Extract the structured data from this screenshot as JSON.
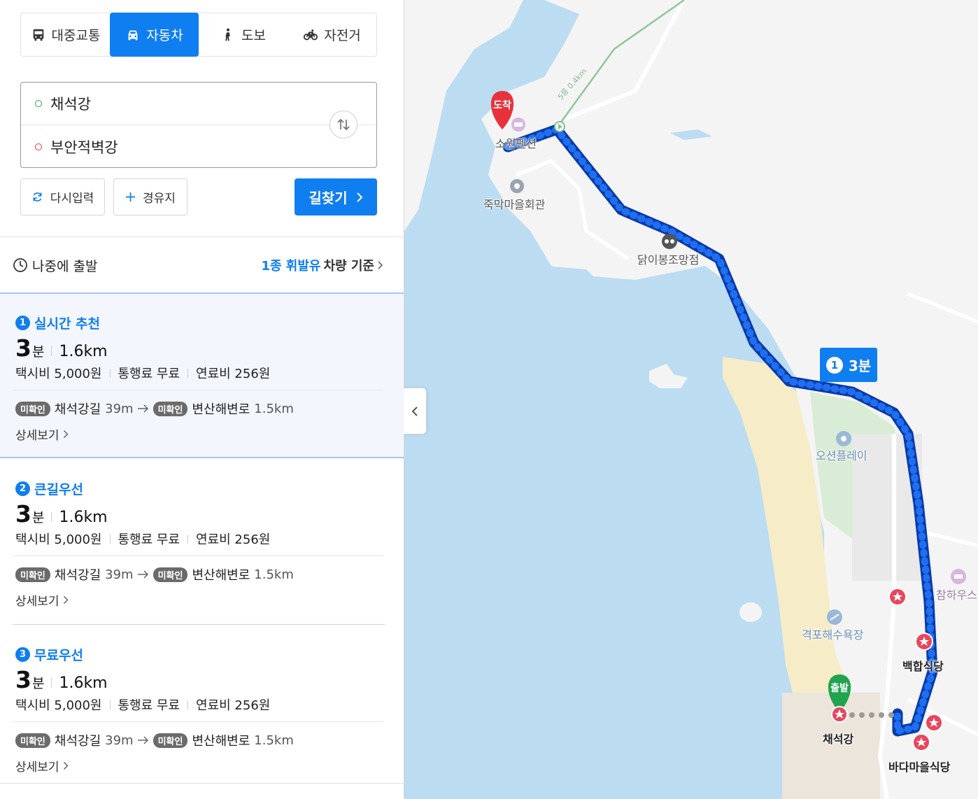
{
  "modes": [
    {
      "label": "대중교통",
      "icon": "bus-icon"
    },
    {
      "label": "자동차",
      "icon": "car-icon",
      "active": true
    },
    {
      "label": "도보",
      "icon": "walk-icon"
    },
    {
      "label": "자전거",
      "icon": "bicycle-icon"
    }
  ],
  "route": {
    "origin": "채석강",
    "destination": "부안적벽강"
  },
  "buttons": {
    "reset": "다시입력",
    "via": "경유지",
    "search": "길찾기"
  },
  "options": {
    "depart_later": "나중에 출발",
    "vehicle_highlight": "1종 휘발유",
    "vehicle_suffix": "차량 기준"
  },
  "routes": [
    {
      "num": "1",
      "title": "실시간 추천",
      "minutes": "3",
      "unit": "분",
      "distance": "1.6km",
      "taxi": "택시비 5,000원",
      "toll": "통행료 무료",
      "fuel": "연료비 256원",
      "chip1": "미확인",
      "road1": "채석강길",
      "road1_dist": "39m",
      "chip2": "미확인",
      "road2": "변산해변로",
      "road2_dist": "1.5km",
      "detail": "상세보기"
    },
    {
      "num": "2",
      "title": "큰길우선",
      "minutes": "3",
      "unit": "분",
      "distance": "1.6km",
      "taxi": "택시비 5,000원",
      "toll": "통행료 무료",
      "fuel": "연료비 256원",
      "chip1": "미확인",
      "road1": "채석강길",
      "road1_dist": "39m",
      "chip2": "미확인",
      "road2": "변산해변로",
      "road2_dist": "1.5km",
      "detail": "상세보기"
    },
    {
      "num": "3",
      "title": "무료우선",
      "minutes": "3",
      "unit": "분",
      "distance": "1.6km",
      "taxi": "택시비 5,000원",
      "toll": "통행료 무료",
      "fuel": "연료비 256원",
      "chip1": "미확인",
      "road1": "채석강길",
      "road1_dist": "39m",
      "chip2": "미확인",
      "road2": "변산해변로",
      "road2_dist": "1.5km",
      "detail": "상세보기"
    }
  ],
  "map": {
    "arrival_pin": "도착",
    "departure_pin": "출발",
    "time_badge_num": "1",
    "time_badge": "3분",
    "trail_label": "5릉 0.4km",
    "labels": {
      "pension": "소원펜션",
      "village_hall": "죽막마을회관",
      "observatory": "닭이봉조망점",
      "ocean_play": "오션플레이",
      "beach": "격포해수욕장",
      "baekhap": "백합식당",
      "chaeseokgang": "채석강",
      "bada": "바다마을식당",
      "chamhouse": "참하우스"
    },
    "colors": {
      "route": "#0f5fe0",
      "sea": "#bcdcf2",
      "land": "#f4f4f4",
      "sand": "#f6ecc8",
      "park": "#d9ecd5"
    }
  }
}
